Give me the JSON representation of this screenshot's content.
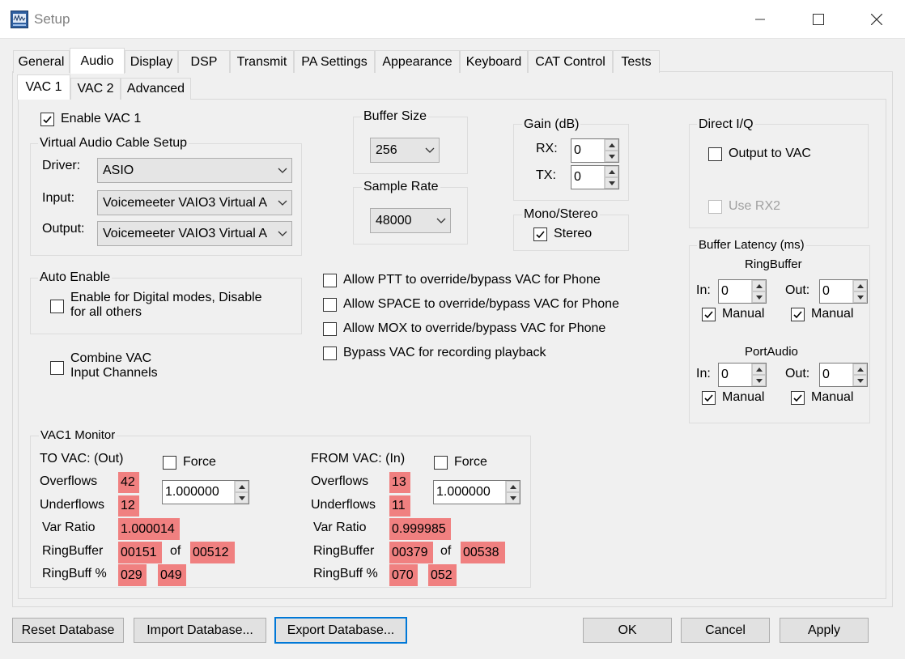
{
  "window": {
    "title": "Setup",
    "controls": {
      "minimize": "minimize-icon",
      "maximize": "maximize-icon",
      "close": "close-icon"
    }
  },
  "tabs": [
    "General",
    "Audio",
    "Display",
    "DSP",
    "Transmit",
    "PA Settings",
    "Appearance",
    "Keyboard",
    "CAT Control",
    "Tests"
  ],
  "active_tab": "Audio",
  "subtabs": [
    "VAC 1",
    "VAC 2",
    "Advanced"
  ],
  "active_subtab": "VAC 1",
  "enable_vac": {
    "label": "Enable VAC 1",
    "checked": true
  },
  "vac_setup": {
    "title": "Virtual Audio Cable Setup",
    "driver_label": "Driver:",
    "driver_value": "ASIO",
    "input_label": "Input:",
    "input_value": "Voicemeeter VAIO3 Virtual A",
    "output_label": "Output:",
    "output_value": "Voicemeeter VAIO3 Virtual A"
  },
  "auto_enable": {
    "title": "Auto Enable",
    "option_line1": "Enable for Digital modes, Disable",
    "option_line2": "for all others",
    "checked": false
  },
  "combine_vac": {
    "line1": "Combine VAC",
    "line2": "Input Channels",
    "checked": false
  },
  "buffer_size": {
    "title": "Buffer Size",
    "value": "256"
  },
  "sample_rate": {
    "title": "Sample Rate",
    "value": "48000"
  },
  "gain": {
    "title": "Gain (dB)",
    "rx_label": "RX:",
    "rx_value": "0",
    "tx_label": "TX:",
    "tx_value": "0"
  },
  "mono_stereo": {
    "title": "Mono/Stereo",
    "stereo_label": "Stereo",
    "checked": true
  },
  "options": [
    {
      "label": "Allow PTT to override/bypass VAC for Phone",
      "checked": false
    },
    {
      "label": "Allow SPACE to override/bypass VAC for Phone",
      "checked": false
    },
    {
      "label": "Allow MOX to override/bypass VAC for Phone",
      "checked": false
    },
    {
      "label": "Bypass VAC for recording playback",
      "checked": false
    }
  ],
  "direct_iq": {
    "title": "Direct I/Q",
    "output_label": "Output to VAC",
    "output_checked": false,
    "rx2_label": "Use RX2",
    "rx2_checked": false
  },
  "buffer_latency": {
    "title": "Buffer Latency (ms)",
    "ringbuffer": {
      "title": "RingBuffer",
      "in_label": "In:",
      "in_value": "0",
      "out_label": "Out:",
      "out_value": "0",
      "manual_label": "Manual"
    },
    "portaudio": {
      "title": "PortAudio",
      "in_label": "In:",
      "in_value": "0",
      "out_label": "Out:",
      "out_value": "0",
      "manual_label": "Manual"
    }
  },
  "monitor": {
    "title": "VAC1 Monitor",
    "to": {
      "header": "TO VAC: (Out)",
      "force_label": "Force",
      "force_value": "1.000000",
      "overflows_label": "Overflows",
      "overflows": "42",
      "underflows_label": "Underflows",
      "underflows": "12",
      "var_ratio_label": "Var Ratio",
      "var_ratio": "1.000014",
      "ringbuffer_label": "RingBuffer",
      "rb_used": "00151",
      "of_label": "of",
      "rb_total": "00512",
      "ringbuff_pct_label": "RingBuff %",
      "pct1": "029",
      "pct2": "049"
    },
    "from": {
      "header": "FROM VAC: (In)",
      "force_label": "Force",
      "force_value": "1.000000",
      "overflows_label": "Overflows",
      "overflows": "13",
      "underflows_label": "Underflows",
      "underflows": "11",
      "var_ratio_label": "Var Ratio",
      "var_ratio": "0.999985",
      "ringbuffer_label": "RingBuffer",
      "rb_used": "00379",
      "of_label": "of",
      "rb_total": "00538",
      "ringbuff_pct_label": "RingBuff %",
      "pct1": "070",
      "pct2": "052"
    }
  },
  "footer": {
    "reset": "Reset Database",
    "import": "Import Database...",
    "export": "Export Database...",
    "ok": "OK",
    "cancel": "Cancel",
    "apply": "Apply"
  },
  "colors": {
    "monitor_value_bg": "#f08080",
    "focus_border": "#0078d7"
  }
}
